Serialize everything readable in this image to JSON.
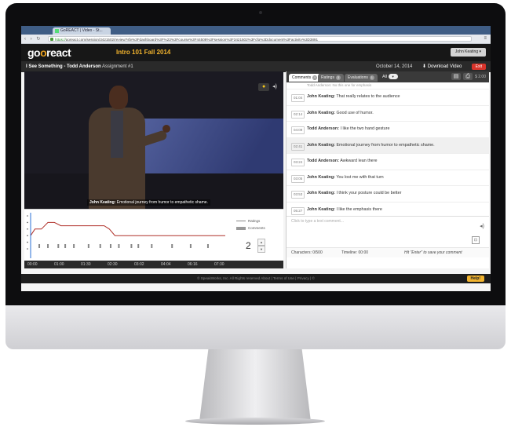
{
  "browser": {
    "tab_title": "GoREACT | Video - St...",
    "url_scheme": "https://",
    "url_host": "goreact.com",
    "url_path": "/session/3421502/review?sfv%3Fdashboard%3F%23%3Fcourse%3F44508%3Fsession%3F3421502%3Fcfg%3Ddocument%3Factivity%3D3891"
  },
  "app": {
    "logo_go": "go",
    "logo_o": "o",
    "logo_react": "react",
    "course_title": "Intro 101 Fall 2014",
    "user_button": "John Keating ▾"
  },
  "subheader": {
    "video_title": "I See Something - Todd Anderson",
    "assignment": "Assignment #1",
    "date": "October 14, 2014",
    "download_label": "Download Video",
    "exit_label": "Exit"
  },
  "video": {
    "caption_author": "John Keating:",
    "caption_text": "Emotional journey from humor to empathetic shame."
  },
  "graph": {
    "legend_ratings": "Ratings",
    "legend_comments": "Comments",
    "stepper_value": "2",
    "stepper_up": "▲",
    "stepper_down": "▼",
    "time_ticks": [
      "00:00",
      "01:00",
      "01:30",
      "02:30",
      "03:02",
      "04:04",
      "06:16",
      "07:30"
    ]
  },
  "panel": {
    "tabs": [
      {
        "label": "Comments",
        "count": "20"
      },
      {
        "label": "Ratings",
        "count": "3"
      },
      {
        "label": "Evaluations",
        "count": "1"
      }
    ],
    "filter_label": "All",
    "filter_dropdown": "▼",
    "price_label": "$ 2.00",
    "first_partial": "Todd Anderson: No this one for emphasis",
    "comments": [
      {
        "time": "01:04",
        "author": "John Keating:",
        "text": "That really relates to the audience",
        "highlight": false
      },
      {
        "time": "02:14",
        "author": "John Keating:",
        "text": "Good use of humor.",
        "highlight": false
      },
      {
        "time": "04:09",
        "author": "Todd Anderson:",
        "text": "I like the two hand gesture",
        "highlight": false
      },
      {
        "time": "02:41",
        "author": "John Keating:",
        "text": "Emotional journey from humor to empathetic shame.",
        "highlight": true
      },
      {
        "time": "03:24",
        "author": "Todd Anderson:",
        "text": "Awkward lean there",
        "highlight": false
      },
      {
        "time": "03:05",
        "author": "John Keating:",
        "text": "You lost me with that turn",
        "highlight": false
      },
      {
        "time": "03:53",
        "author": "John Keating:",
        "text": "I think your posture could be better",
        "highlight": false
      },
      {
        "time": "05:27",
        "author": "John Keating:",
        "text": "I like the emphasis there",
        "highlight": false
      }
    ],
    "input_placeholder": "Click to type a text comment...",
    "characters": "Characters: 0/500",
    "timeline": "Timeline: 00:00",
    "hint": "Hit \"Enter\" to save your comment"
  },
  "footer": {
    "text": "© SpeakWorks, Inc.   All Rights reserved   About | Terms of Use | Privacy | ©",
    "help_label": "Help!"
  },
  "chart_data": {
    "type": "line",
    "x": [
      "00:00",
      "00:10",
      "00:25",
      "00:40",
      "00:55",
      "01:10",
      "01:30",
      "01:50",
      "02:10",
      "02:30",
      "02:50",
      "03:02",
      "03:15",
      "04:04",
      "05:00",
      "06:16",
      "07:30"
    ],
    "series": [
      {
        "name": "Ratings",
        "values": [
          2,
          3,
          3,
          4,
          4,
          3.5,
          3.5,
          3.5,
          3.5,
          3.5,
          3.5,
          3,
          2,
          2,
          2,
          2,
          2
        ]
      }
    ],
    "comment_markers": [
      "00:20",
      "00:40",
      "01:04",
      "01:20",
      "01:40",
      "02:14",
      "02:41",
      "03:05",
      "03:24",
      "03:53",
      "04:09",
      "04:40",
      "05:27",
      "06:10",
      "06:50"
    ],
    "ylim": [
      0,
      5
    ],
    "grid": false
  }
}
